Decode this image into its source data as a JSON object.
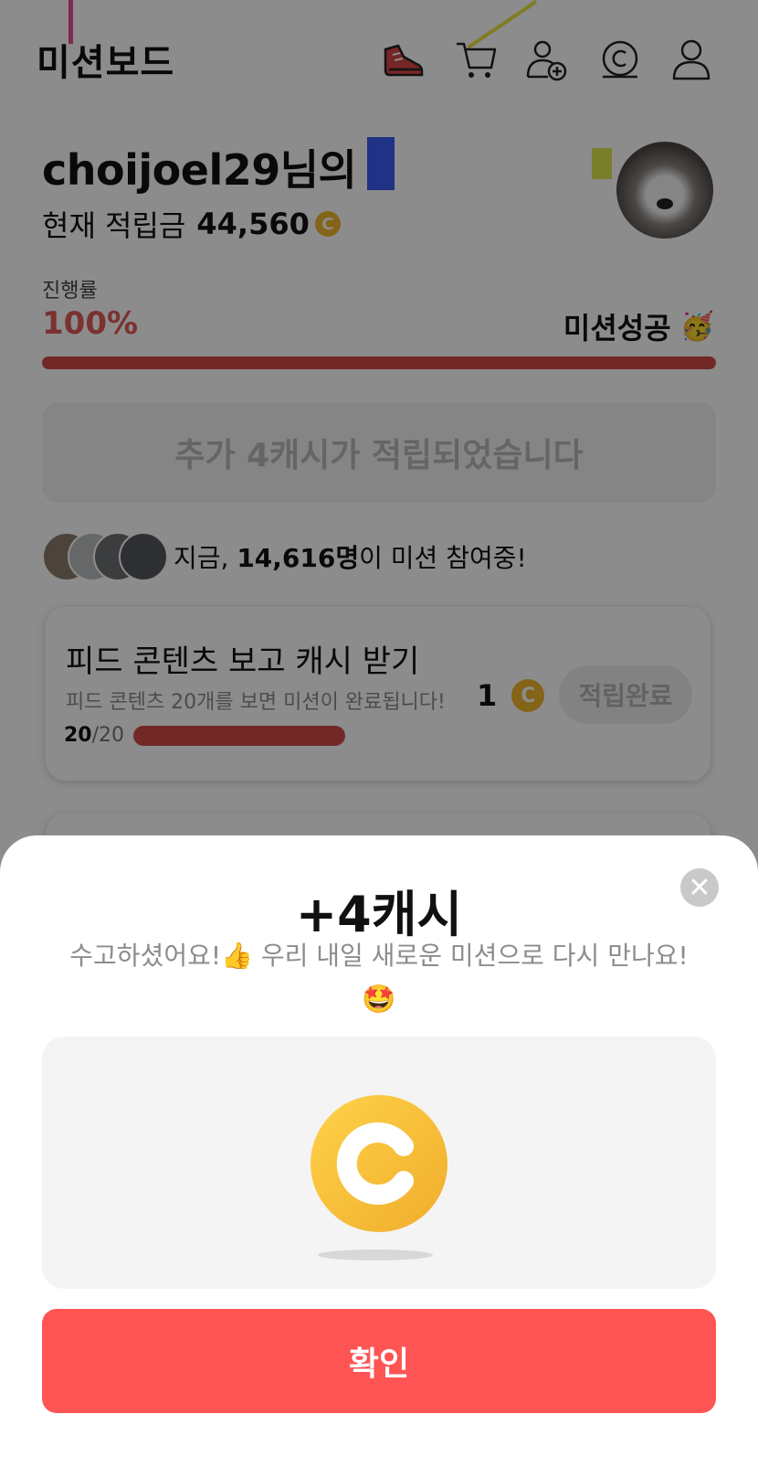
{
  "header": {
    "title": "미션보드",
    "icons": [
      "sneaker-icon",
      "cart-icon",
      "add-friend-icon",
      "cash-coin-icon",
      "profile-icon"
    ]
  },
  "profile": {
    "username": "choijoel29님의",
    "balance_label": "현재 적립금",
    "balance_value": "44,560",
    "coin_symbol": "C"
  },
  "progress": {
    "label": "진행률",
    "value": "100%",
    "fraction": 1.0,
    "status": "미션성공",
    "status_emoji": "🥳"
  },
  "notice": {
    "text": "추가 4캐시가 적립되었습니다"
  },
  "participants": {
    "prefix": "지금, ",
    "count": "14,616명",
    "suffix": "이 미션 참여중!"
  },
  "task": {
    "title": "피드 콘텐츠 보고 캐시 받기",
    "description": "피드 콘텐츠 20개를 보면 미션이 완료됩니다!",
    "reward": "1",
    "status_button": "적립완료",
    "done": "20",
    "total": "/20",
    "fraction": 1.0
  },
  "sheet": {
    "title": "+4캐시",
    "message": "수고하셨어요!👍 우리 내일 새로운 미션으로 다시 만나요!",
    "emoji": "🤩",
    "close_symbol": "✕",
    "confirm_label": "확인"
  },
  "colors": {
    "accent_red": "#ff5454",
    "progress_red": "#d24a4a",
    "coin_gold": "#f1b62c"
  }
}
